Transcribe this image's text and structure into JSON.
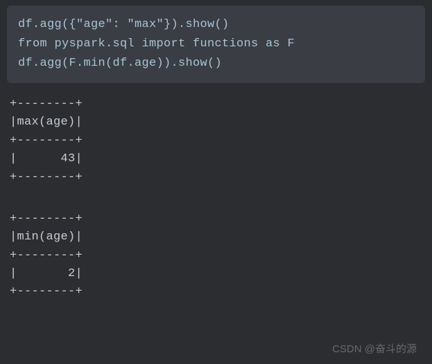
{
  "code": {
    "line1": "df.agg({\"age\": \"max\"}).show()",
    "line2": "",
    "line3": "from pyspark.sql import functions as F",
    "line4": "df.agg(F.min(df.age)).show()"
  },
  "output1": {
    "border": "+--------+",
    "header": "|max(age)|",
    "value": "|      43|"
  },
  "output2": {
    "border": "+--------+",
    "header": "|min(age)|",
    "value": "|       2|"
  },
  "watermark": "CSDN @奋斗的源"
}
